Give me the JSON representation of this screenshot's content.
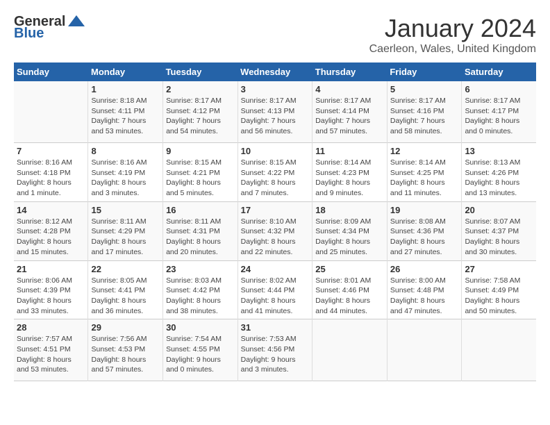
{
  "header": {
    "logo_general": "General",
    "logo_blue": "Blue",
    "title": "January 2024",
    "subtitle": "Caerleon, Wales, United Kingdom"
  },
  "days_of_week": [
    "Sunday",
    "Monday",
    "Tuesday",
    "Wednesday",
    "Thursday",
    "Friday",
    "Saturday"
  ],
  "weeks": [
    [
      {
        "day": "",
        "info": ""
      },
      {
        "day": "1",
        "info": "Sunrise: 8:18 AM\nSunset: 4:11 PM\nDaylight: 7 hours\nand 53 minutes."
      },
      {
        "day": "2",
        "info": "Sunrise: 8:17 AM\nSunset: 4:12 PM\nDaylight: 7 hours\nand 54 minutes."
      },
      {
        "day": "3",
        "info": "Sunrise: 8:17 AM\nSunset: 4:13 PM\nDaylight: 7 hours\nand 56 minutes."
      },
      {
        "day": "4",
        "info": "Sunrise: 8:17 AM\nSunset: 4:14 PM\nDaylight: 7 hours\nand 57 minutes."
      },
      {
        "day": "5",
        "info": "Sunrise: 8:17 AM\nSunset: 4:16 PM\nDaylight: 7 hours\nand 58 minutes."
      },
      {
        "day": "6",
        "info": "Sunrise: 8:17 AM\nSunset: 4:17 PM\nDaylight: 8 hours\nand 0 minutes."
      }
    ],
    [
      {
        "day": "7",
        "info": "Sunrise: 8:16 AM\nSunset: 4:18 PM\nDaylight: 8 hours\nand 1 minute."
      },
      {
        "day": "8",
        "info": "Sunrise: 8:16 AM\nSunset: 4:19 PM\nDaylight: 8 hours\nand 3 minutes."
      },
      {
        "day": "9",
        "info": "Sunrise: 8:15 AM\nSunset: 4:21 PM\nDaylight: 8 hours\nand 5 minutes."
      },
      {
        "day": "10",
        "info": "Sunrise: 8:15 AM\nSunset: 4:22 PM\nDaylight: 8 hours\nand 7 minutes."
      },
      {
        "day": "11",
        "info": "Sunrise: 8:14 AM\nSunset: 4:23 PM\nDaylight: 8 hours\nand 9 minutes."
      },
      {
        "day": "12",
        "info": "Sunrise: 8:14 AM\nSunset: 4:25 PM\nDaylight: 8 hours\nand 11 minutes."
      },
      {
        "day": "13",
        "info": "Sunrise: 8:13 AM\nSunset: 4:26 PM\nDaylight: 8 hours\nand 13 minutes."
      }
    ],
    [
      {
        "day": "14",
        "info": "Sunrise: 8:12 AM\nSunset: 4:28 PM\nDaylight: 8 hours\nand 15 minutes."
      },
      {
        "day": "15",
        "info": "Sunrise: 8:11 AM\nSunset: 4:29 PM\nDaylight: 8 hours\nand 17 minutes."
      },
      {
        "day": "16",
        "info": "Sunrise: 8:11 AM\nSunset: 4:31 PM\nDaylight: 8 hours\nand 20 minutes."
      },
      {
        "day": "17",
        "info": "Sunrise: 8:10 AM\nSunset: 4:32 PM\nDaylight: 8 hours\nand 22 minutes."
      },
      {
        "day": "18",
        "info": "Sunrise: 8:09 AM\nSunset: 4:34 PM\nDaylight: 8 hours\nand 25 minutes."
      },
      {
        "day": "19",
        "info": "Sunrise: 8:08 AM\nSunset: 4:36 PM\nDaylight: 8 hours\nand 27 minutes."
      },
      {
        "day": "20",
        "info": "Sunrise: 8:07 AM\nSunset: 4:37 PM\nDaylight: 8 hours\nand 30 minutes."
      }
    ],
    [
      {
        "day": "21",
        "info": "Sunrise: 8:06 AM\nSunset: 4:39 PM\nDaylight: 8 hours\nand 33 minutes."
      },
      {
        "day": "22",
        "info": "Sunrise: 8:05 AM\nSunset: 4:41 PM\nDaylight: 8 hours\nand 36 minutes."
      },
      {
        "day": "23",
        "info": "Sunrise: 8:03 AM\nSunset: 4:42 PM\nDaylight: 8 hours\nand 38 minutes."
      },
      {
        "day": "24",
        "info": "Sunrise: 8:02 AM\nSunset: 4:44 PM\nDaylight: 8 hours\nand 41 minutes."
      },
      {
        "day": "25",
        "info": "Sunrise: 8:01 AM\nSunset: 4:46 PM\nDaylight: 8 hours\nand 44 minutes."
      },
      {
        "day": "26",
        "info": "Sunrise: 8:00 AM\nSunset: 4:48 PM\nDaylight: 8 hours\nand 47 minutes."
      },
      {
        "day": "27",
        "info": "Sunrise: 7:58 AM\nSunset: 4:49 PM\nDaylight: 8 hours\nand 50 minutes."
      }
    ],
    [
      {
        "day": "28",
        "info": "Sunrise: 7:57 AM\nSunset: 4:51 PM\nDaylight: 8 hours\nand 53 minutes."
      },
      {
        "day": "29",
        "info": "Sunrise: 7:56 AM\nSunset: 4:53 PM\nDaylight: 8 hours\nand 57 minutes."
      },
      {
        "day": "30",
        "info": "Sunrise: 7:54 AM\nSunset: 4:55 PM\nDaylight: 9 hours\nand 0 minutes."
      },
      {
        "day": "31",
        "info": "Sunrise: 7:53 AM\nSunset: 4:56 PM\nDaylight: 9 hours\nand 3 minutes."
      },
      {
        "day": "",
        "info": ""
      },
      {
        "day": "",
        "info": ""
      },
      {
        "day": "",
        "info": ""
      }
    ]
  ]
}
